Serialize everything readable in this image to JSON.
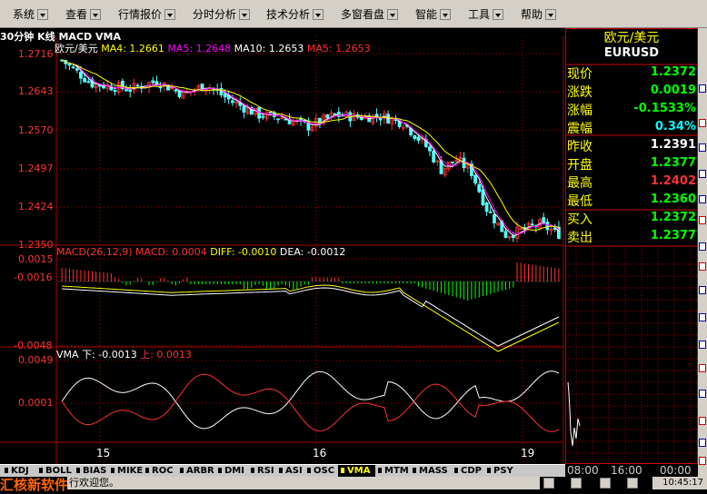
{
  "menu": [
    {
      "label": "系统"
    },
    {
      "label": "查看"
    },
    {
      "label": "行情报价"
    },
    {
      "label": "分时分析"
    },
    {
      "label": "技术分析"
    },
    {
      "label": "多窗看盘"
    },
    {
      "label": "智能"
    },
    {
      "label": "工具"
    },
    {
      "label": "帮助"
    }
  ],
  "chart": {
    "title": "30分钟 K线 MACD VMA",
    "legend_main": {
      "symbol": "欧元/美元",
      "ma4": "MA4: 1.2661",
      "ma5a": "MA5: 1.2648",
      "ma10": "MA10: 1.2653",
      "ma5b": "MA5: 1.2653"
    },
    "legend_macd": {
      "macd": "MACD(26,12,9) MACD: 0.0004",
      "diff": "DIFF: -0.0010",
      "dea": "DEA: -0.0012"
    },
    "legend_vma": {
      "down": "VMA 下: -0.0013",
      "up_label": "上:",
      "up_value": "0.0013"
    },
    "price_ticks": [
      "1.2716",
      "1.2643",
      "1.2570",
      "1.2497",
      "1.2424",
      "1.2350"
    ],
    "macd_ticks": [
      "0.0015",
      "-0.0016",
      "-0.0048"
    ],
    "vma_ticks": [
      "0.0049",
      "0.0001"
    ],
    "x_labels": [
      "15",
      "16",
      "19"
    ],
    "colors": {
      "up": "#ff3232",
      "down": "#54ffff",
      "ma_white": "#ffffff",
      "ma_yellow": "#ffff00",
      "ma_magenta": "#ff00ff",
      "grid": "#aa0000",
      "macd_red": "#ff3232",
      "macd_green": "#00ff00"
    }
  },
  "quote": {
    "title": "欧元/美元",
    "code": "EURUSD",
    "rows": [
      {
        "label": "现价",
        "value": "1.2372",
        "color": "#00ff00"
      },
      {
        "label": "涨跌",
        "value": "0.0019",
        "color": "#00ff00"
      },
      {
        "label": "涨幅",
        "value": "-0.1533%",
        "color": "#00ff00"
      },
      {
        "label": "震幅",
        "value": "0.34%",
        "color": "#00ffff"
      },
      {
        "label": "昨收",
        "value": "1.2391",
        "color": "#ffffff"
      },
      {
        "label": "开盘",
        "value": "1.2377",
        "color": "#00ff00"
      },
      {
        "label": "最高",
        "value": "1.2402",
        "color": "#ff3232"
      },
      {
        "label": "最低",
        "value": "1.2360",
        "color": "#00ff00"
      },
      {
        "label": "买入",
        "value": "1.2372",
        "color": "#00ff00"
      },
      {
        "label": "卖出",
        "value": "1.2377",
        "color": "#00ff00"
      }
    ],
    "time_labels": [
      "08:00",
      "16:00",
      "00:00"
    ]
  },
  "tabs": [
    {
      "label": "KDJ"
    },
    {
      "label": "BOLL"
    },
    {
      "label": "BIAS"
    },
    {
      "label": "MIKE"
    },
    {
      "label": "ROC"
    },
    {
      "label": "ARBR"
    },
    {
      "label": "DMI"
    },
    {
      "label": "RSI"
    },
    {
      "label": "ASI"
    },
    {
      "label": "OSC"
    },
    {
      "label": "VMA",
      "active": true
    },
    {
      "label": "MTM"
    },
    {
      "label": "MASS"
    },
    {
      "label": "CDP"
    },
    {
      "label": "PSY"
    }
  ],
  "status": {
    "brand": "汇核新软件",
    "welcome": "行欢迎您。",
    "clock": "10:45:17"
  }
}
